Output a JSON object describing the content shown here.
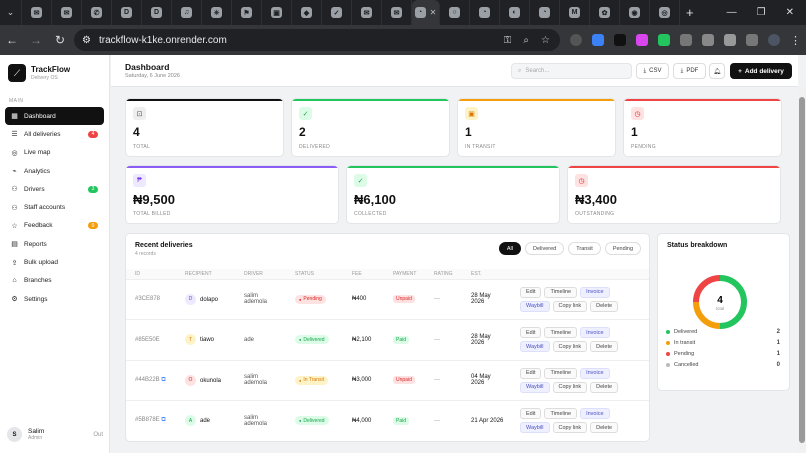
{
  "browser": {
    "tabs": [
      {
        "icon": "✉"
      },
      {
        "icon": "✉"
      },
      {
        "icon": "✆"
      },
      {
        "icon": "D"
      },
      {
        "icon": "D"
      },
      {
        "icon": "♫"
      },
      {
        "icon": "✳"
      },
      {
        "icon": "⚑"
      },
      {
        "icon": "▣"
      },
      {
        "icon": "◆"
      },
      {
        "icon": "✓"
      },
      {
        "icon": "✉"
      },
      {
        "icon": "✉"
      },
      {
        "icon": "◔",
        "active": true
      },
      {
        "icon": "○"
      },
      {
        "icon": "◔"
      },
      {
        "icon": "◐"
      },
      {
        "icon": "◔"
      },
      {
        "icon": "M"
      },
      {
        "icon": "✿"
      },
      {
        "icon": "◉"
      },
      {
        "icon": "◎"
      }
    ],
    "url": "trackflow-k1ke.onrender.com"
  },
  "brand": {
    "name": "TrackFlow",
    "sub": "Delivery OS"
  },
  "sidebar": {
    "section": "MAIN",
    "items": [
      {
        "label": "Dashboard",
        "icon": "▦",
        "active": true
      },
      {
        "label": "All deliveries",
        "icon": "☰",
        "badge": "4",
        "badge_color": "#ef4444"
      },
      {
        "label": "Live map",
        "icon": "◎"
      },
      {
        "label": "Analytics",
        "icon": "⌁"
      },
      {
        "label": "Drivers",
        "icon": "⚇",
        "badge": "3",
        "badge_color": "#22c55e"
      },
      {
        "label": "Staff accounts",
        "icon": "⚇"
      },
      {
        "label": "Feedback",
        "icon": "☆",
        "badge": "0",
        "badge_color": "#f59e0b"
      },
      {
        "label": "Reports",
        "icon": "▤"
      },
      {
        "label": "Bulk upload",
        "icon": "⇪"
      },
      {
        "label": "Branches",
        "icon": "⌂"
      },
      {
        "label": "Settings",
        "icon": "⚙"
      }
    ],
    "user": {
      "initial": "S",
      "name": "Salim",
      "role": "Admin",
      "logout": "Out"
    }
  },
  "header": {
    "title": "Dashboard",
    "date": "Saturday, 6 June 2026",
    "search_placeholder": "Search...",
    "csv": "CSV",
    "pdf": "PDF",
    "add": "Add delivery"
  },
  "stats": [
    {
      "value": "4",
      "label": "TOTAL",
      "color": "#111111",
      "icon": "⊡",
      "bg": "#eeeeee",
      "fg": "#555555"
    },
    {
      "value": "2",
      "label": "DELIVERED",
      "color": "#22c55e",
      "icon": "✓",
      "bg": "#dcfce7",
      "fg": "#16a34a"
    },
    {
      "value": "1",
      "label": "IN TRANSIT",
      "color": "#f59e0b",
      "icon": "▣",
      "bg": "#fef3c7",
      "fg": "#d97706"
    },
    {
      "value": "1",
      "label": "PENDING",
      "color": "#ef4444",
      "icon": "◷",
      "bg": "#fee2e2",
      "fg": "#dc2626"
    }
  ],
  "money": [
    {
      "value": "₦9,500",
      "label": "TOTAL BILLED",
      "color": "#8b5cf6",
      "icon": "₱",
      "bg": "#ede9fe",
      "fg": "#7c3aed"
    },
    {
      "value": "₦6,100",
      "label": "COLLECTED",
      "color": "#22c55e",
      "icon": "✓",
      "bg": "#dcfce7",
      "fg": "#16a34a"
    },
    {
      "value": "₦3,400",
      "label": "OUTSTANDING",
      "color": "#ef4444",
      "icon": "◷",
      "bg": "#fee2e2",
      "fg": "#dc2626"
    }
  ],
  "recent": {
    "title": "Recent deliveries",
    "subtitle": "4 records",
    "filters": [
      "All",
      "Delivered",
      "Transit",
      "Pending"
    ],
    "columns": [
      "ID",
      "RECIPIENT",
      "DRIVER",
      "STATUS",
      "FEE",
      "PAYMENT",
      "RATING",
      "EST."
    ],
    "rows": [
      {
        "id": "#3CE878",
        "initial": "D",
        "recipient": "dolapo",
        "driver": "salim ademola",
        "status": "Pending",
        "fee": "₦400",
        "payment": "Unpaid",
        "rating": "—",
        "est": "28 May 2026",
        "av_bg": "#ede9fe",
        "av_fg": "#7c3aed",
        "st_bg": "#fee2e2",
        "st_fg": "#dc2626",
        "pay_bg": "#fee2e2",
        "pay_fg": "#dc2626"
      },
      {
        "id": "#85E50E",
        "initial": "T",
        "recipient": "tiawo",
        "driver": "ade",
        "status": "Delivered",
        "fee": "₦2,100",
        "payment": "Paid",
        "rating": "—",
        "est": "28 May 2026",
        "av_bg": "#fef3c7",
        "av_fg": "#d97706",
        "st_bg": "#dcfce7",
        "st_fg": "#16a34a",
        "pay_bg": "#dcfce7",
        "pay_fg": "#16a34a"
      },
      {
        "id": "#44B22B",
        "initial": "O",
        "recipient": "okunola",
        "driver": "salim ademola",
        "status": "In Transit",
        "fee": "₦3,000",
        "payment": "Unpaid",
        "rating": "—",
        "est": "04 May 2026",
        "av_bg": "#fee2e2",
        "av_fg": "#dc2626",
        "st_bg": "#fef3c7",
        "st_fg": "#d97706",
        "pay_bg": "#fee2e2",
        "pay_fg": "#dc2626"
      },
      {
        "id": "#5B878E",
        "initial": "A",
        "recipient": "ade",
        "driver": "salim ademola",
        "status": "Delivered",
        "fee": "₦4,000",
        "payment": "Paid",
        "rating": "—",
        "est": "21 Apr 2026",
        "av_bg": "#dcfce7",
        "av_fg": "#16a34a",
        "st_bg": "#dcfce7",
        "st_fg": "#16a34a",
        "pay_bg": "#dcfce7",
        "pay_fg": "#16a34a"
      }
    ],
    "actions": [
      "Edit",
      "Timeline",
      "Invoice",
      "Waybill",
      "Copy link",
      "Delete"
    ]
  },
  "breakdown": {
    "title": "Status breakdown",
    "total": "4",
    "total_label": "total",
    "items": [
      {
        "label": "Delivered",
        "count": "2",
        "value": 2,
        "color": "#22c55e"
      },
      {
        "label": "In transit",
        "count": "1",
        "value": 1,
        "color": "#f59e0b"
      },
      {
        "label": "Pending",
        "count": "1",
        "value": 1,
        "color": "#ef4444"
      },
      {
        "label": "Cancelled",
        "count": "0",
        "value": 0,
        "color": "#bbbbbb"
      }
    ]
  }
}
